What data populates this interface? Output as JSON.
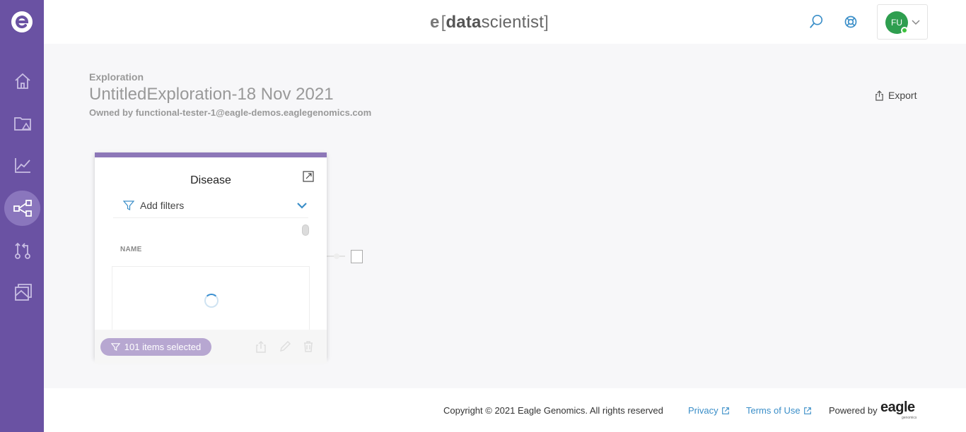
{
  "brand": {
    "e": "e",
    "open": "[",
    "data": "data",
    "scientist": "scientist",
    "close": "]"
  },
  "user": {
    "initials": "FU"
  },
  "header": {
    "section": "Exploration",
    "title": "UntitledExploration-18 Nov 2021",
    "owner": "Owned by functional-tester-1@eagle-demos.eaglegenomics.com",
    "export_label": "Export"
  },
  "card": {
    "title": "Disease",
    "filter_label": "Add filters",
    "column_header": "NAME",
    "selected_label": "101 items selected"
  },
  "footer": {
    "copyright": "Copyright © 2021 Eagle Genomics. All rights reserved",
    "privacy": "Privacy",
    "terms": "Terms of Use",
    "powered_by": "Powered by",
    "eagle_logo": "eagle",
    "eagle_sub": "genomics"
  },
  "icons": {
    "sidebar": [
      "home-icon",
      "datasets-icon",
      "chart-icon",
      "exploration-icon",
      "workflow-icon",
      "reports-icon"
    ],
    "top": [
      "search-icon",
      "help-lifebuoy-icon",
      "chevron-down-icon"
    ]
  },
  "colors": {
    "sidebar": "#6a52a3",
    "sidebar_active": "#8a76bd",
    "card_accent": "#8d77b8",
    "pill": "#b7a7d1",
    "link": "#3a8ec8",
    "avatar": "#2e9e4f"
  }
}
